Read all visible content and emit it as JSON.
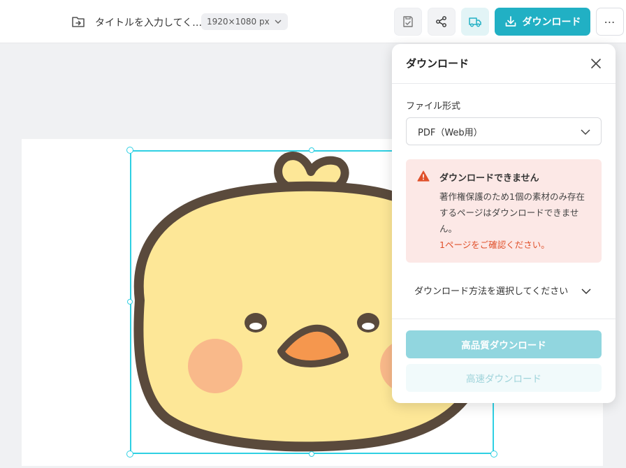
{
  "header": {
    "title": "タイトルを入力してく…",
    "canvas_size": "1920×1080 px",
    "download_label": "ダウンロード",
    "more_label": "⋯"
  },
  "download_panel": {
    "title": "ダウンロード",
    "file_format_label": "ファイル形式",
    "file_format_value": "PDF（Web用）",
    "alert": {
      "title": "ダウンロードできません",
      "body": "著作権保護のため1個の素材のみ存在するページはダウンロードできません。",
      "link": "1ページをご確認ください。"
    },
    "method_placeholder": "ダウンロード方法を選択してください",
    "high_quality_label": "高品質ダウンロード",
    "fast_label": "高速ダウンロード"
  },
  "colors": {
    "accent": "#21b0c4",
    "alert_bg": "#fce8e6",
    "alert_icon": "#e0502a",
    "selection": "#2fd0e3",
    "chick_body": "#fde797",
    "chick_outline": "#5a4a3c",
    "chick_cheek": "#f9b98a",
    "chick_beak": "#f5974e"
  },
  "icons": {
    "folder": "folder-arrow-icon",
    "chevron": "chevron-down-icon",
    "save": "save-check-icon",
    "share": "share-icon",
    "truck": "truck-icon",
    "download": "download-icon",
    "more": "more-horizontal-icon",
    "close": "close-icon",
    "warning": "warning-icon"
  }
}
